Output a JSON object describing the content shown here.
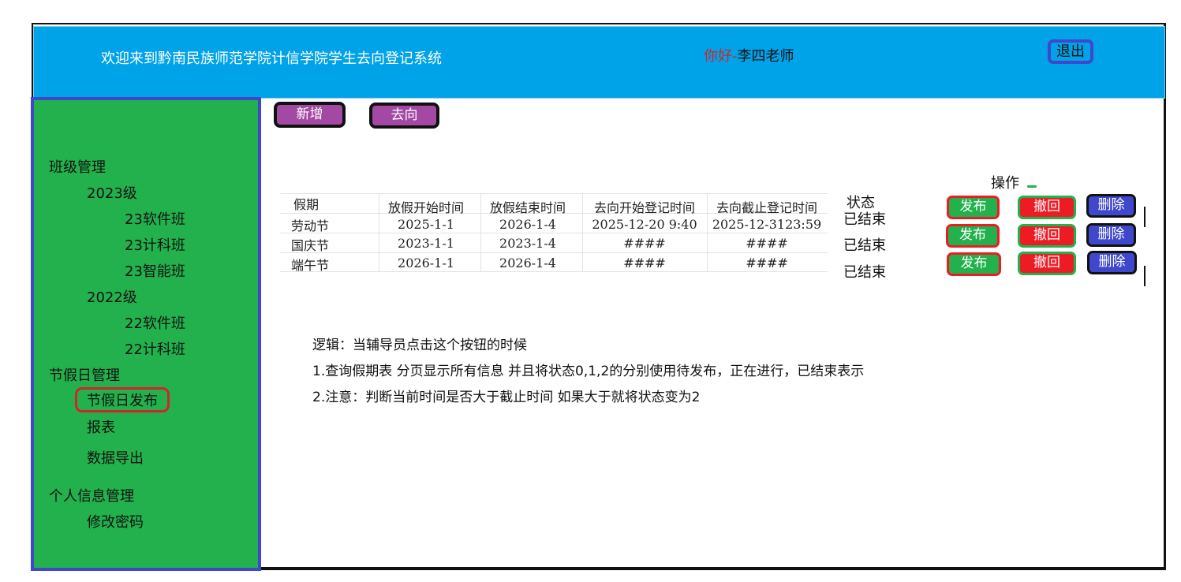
{
  "header": {
    "title": "欢迎来到黔南民族师范学院计信学院学生去向登记系统",
    "greeting": "你好",
    "separator": "-",
    "user": "李四老师",
    "logout_label": "退出"
  },
  "sidebar": {
    "items": [
      {
        "label": "班级管理"
      },
      {
        "label": "2023级"
      },
      {
        "label": "23软件班"
      },
      {
        "label": "23计科班"
      },
      {
        "label": "23智能班"
      },
      {
        "label": "2022级"
      },
      {
        "label": "22软件班"
      },
      {
        "label": "22计科班"
      },
      {
        "label": "节假日管理"
      },
      {
        "label": "节假日发布"
      },
      {
        "label": "报表"
      },
      {
        "label": "数据导出"
      },
      {
        "label": "个人信息管理"
      },
      {
        "label": "修改密码"
      }
    ]
  },
  "toolbar": {
    "add_label": "新增",
    "direction_label": "去向"
  },
  "table": {
    "headers": [
      "假期",
      "放假开始时间",
      "放假结束时间",
      "去向开始登记时间",
      "去向截止登记时间"
    ],
    "status_header": "状态",
    "ops_header": "操作",
    "rows": [
      {
        "holiday": "劳动节",
        "start": "2025-1-1",
        "end": "2026-1-4",
        "reg_start": "2025-12-20 9:40",
        "reg_end": "2025-12-3123:59",
        "status": "已结束"
      },
      {
        "holiday": "国庆节",
        "start": "2023-1-1",
        "end": "2023-1-4",
        "reg_start": "####",
        "reg_end": "####",
        "status": "已结束"
      },
      {
        "holiday": "端午节",
        "start": "2026-1-1",
        "end": "2026-1-4",
        "reg_start": "####",
        "reg_end": "####",
        "status": "已结束"
      }
    ],
    "actions": {
      "publish": "发布",
      "revoke": "撤回",
      "delete": "删除"
    }
  },
  "notes": [
    "逻辑：当辅导员点击这个按钮的时候",
    "1.查询假期表 分页显示所有信息 并且将状态0,1,2的分别使用待发布，正在进行，已结束表示",
    "2.注意：判断当前时间是否大于截止时间 如果大于就将状态变为2"
  ],
  "colors": {
    "header_bg": "#00a2e8",
    "sidebar_bg": "#22b14c",
    "sidebar_border": "#3f48cc",
    "highlight_red": "#d0252a",
    "purple_button": "#a349a4"
  }
}
